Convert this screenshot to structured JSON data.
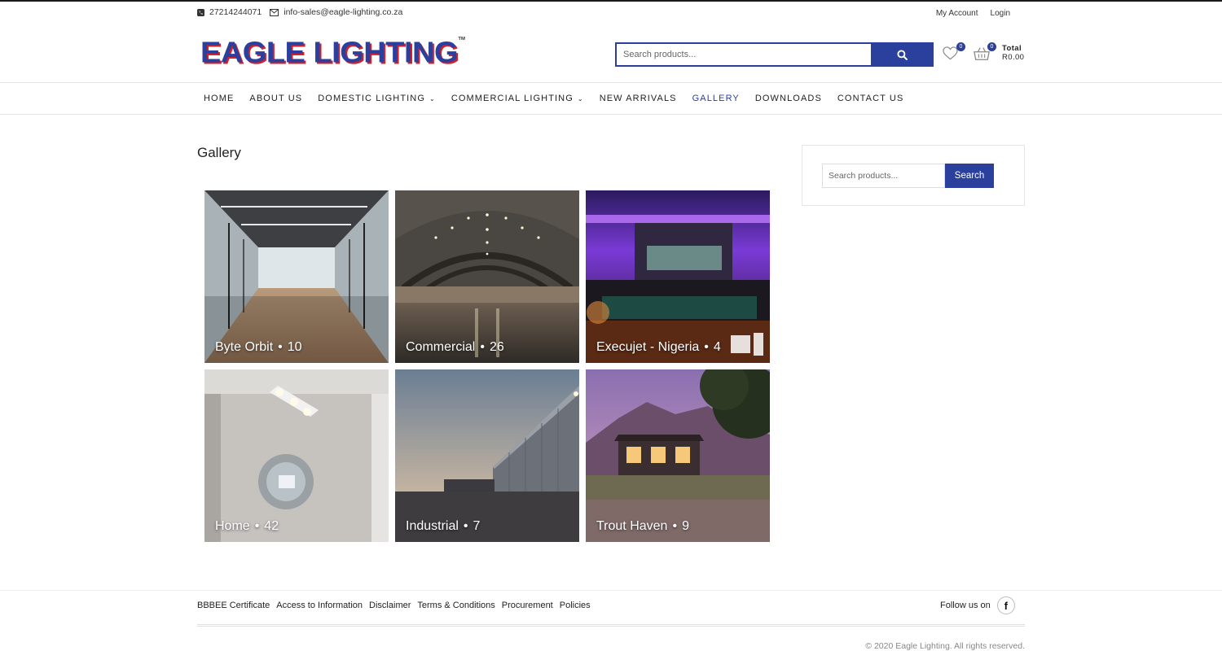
{
  "topbar": {
    "phone": "27214244071",
    "email": "info-sales@eagle-lighting.co.za",
    "my_account": "My Account",
    "login": "Login"
  },
  "header": {
    "logo_text": "EAGLE LIGHTING",
    "logo_tm": "TM",
    "search_placeholder": "Search products...",
    "wishlist_count": "0",
    "cart_count": "0",
    "cart_total_label": "Total",
    "cart_total_value": "R0.00"
  },
  "nav": {
    "items": [
      {
        "label": "HOME"
      },
      {
        "label": "ABOUT US"
      },
      {
        "label": "DOMESTIC LIGHTING",
        "chevron": "⌄"
      },
      {
        "label": "COMMERCIAL LIGHTING",
        "chevron": "⌄"
      },
      {
        "label": "NEW ARRIVALS"
      },
      {
        "label": "GALLERY"
      },
      {
        "label": "DOWNLOADS"
      },
      {
        "label": "CONTACT US"
      }
    ]
  },
  "page": {
    "title": "Gallery"
  },
  "gallery": {
    "separator": "•",
    "tiles": [
      {
        "name": "Byte Orbit",
        "count": "10"
      },
      {
        "name": "Commercial",
        "count": "26"
      },
      {
        "name": "Execujet - Nigeria",
        "count": "4"
      },
      {
        "name": "Home",
        "count": "42"
      },
      {
        "name": "Industrial",
        "count": "7"
      },
      {
        "name": "Trout Haven",
        "count": "9"
      }
    ]
  },
  "sidebar": {
    "search_placeholder": "Search products...",
    "search_button": "Search"
  },
  "footer": {
    "links": [
      "BBBEE Certificate",
      "Access to Information",
      "Disclaimer",
      "Terms & Conditions",
      "Procurement",
      "Policies"
    ],
    "follow_label": "Follow us on",
    "facebook_glyph": "f",
    "copyright": "© 2020 Eagle Lighting. All rights reserved."
  },
  "colors": {
    "brand_blue": "#2b3f9c",
    "brand_red": "#d3202a"
  }
}
